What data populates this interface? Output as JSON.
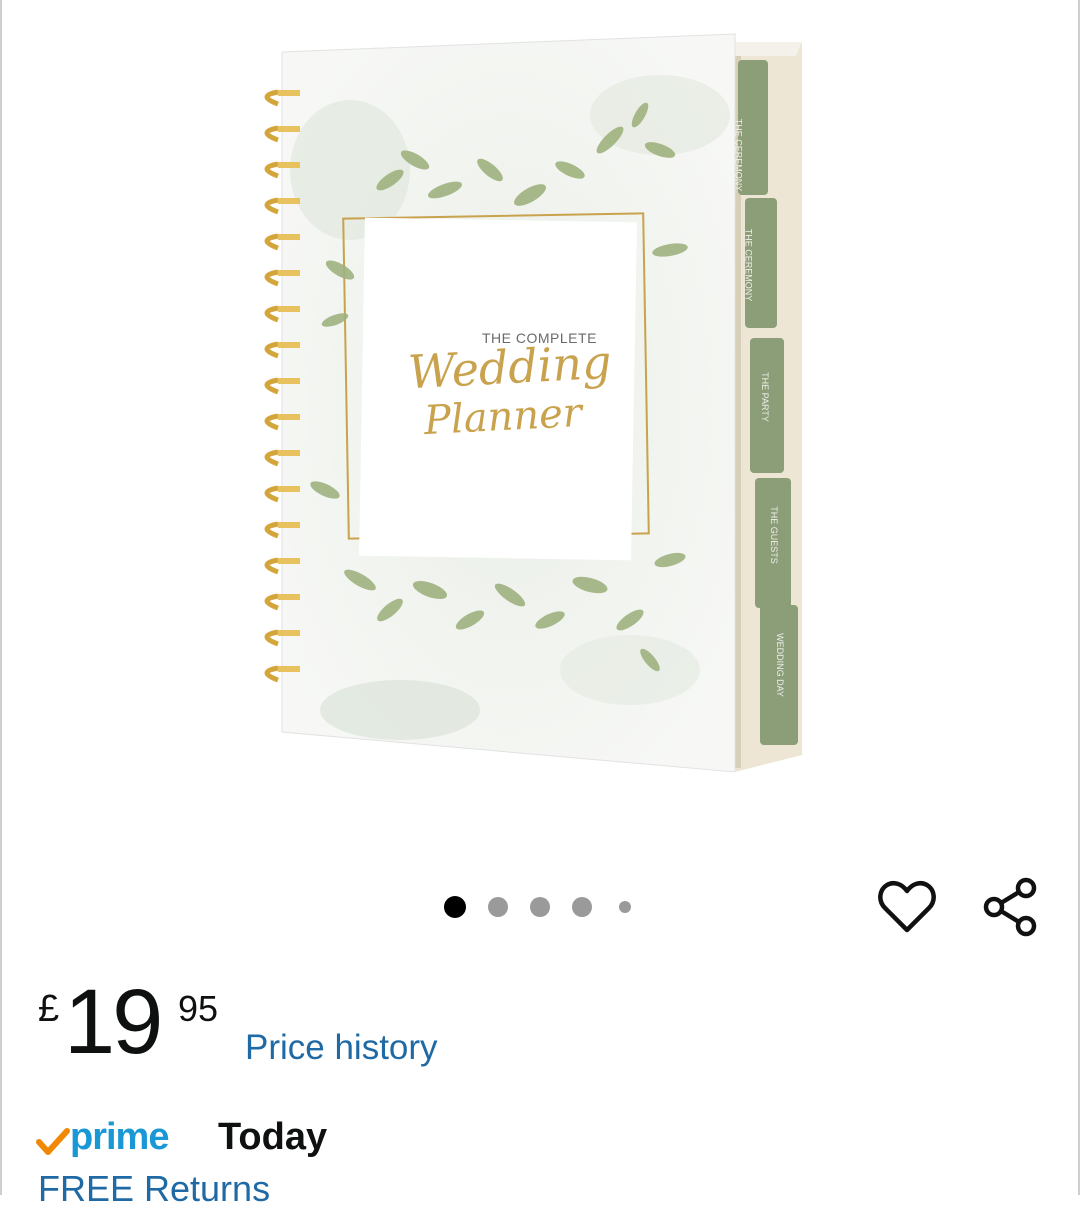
{
  "product": {
    "cover_title_small": "THE COMPLETE",
    "cover_title_line1": "Wedding",
    "cover_title_line2": "Planner",
    "tabs": [
      "THE CEREMONY",
      "THE CEREMONY",
      "THE PARTY",
      "THE GUESTS",
      "WEDDING DAY"
    ]
  },
  "carousel": {
    "total": 5,
    "active_index": 0
  },
  "actions": {
    "wishlist_icon": "heart-icon",
    "share_icon": "share-icon"
  },
  "price": {
    "currency": "£",
    "whole": "19",
    "fraction": "95"
  },
  "links": {
    "price_history": "Price history"
  },
  "delivery": {
    "prime_label": "prime",
    "when": "Today",
    "returns": "FREE Returns"
  },
  "colors": {
    "link": "#1f6aa5",
    "prime_blue": "#1a98d5",
    "prime_check": "#f08804",
    "sage": "#8b9e78",
    "gold": "#c9a24e"
  }
}
